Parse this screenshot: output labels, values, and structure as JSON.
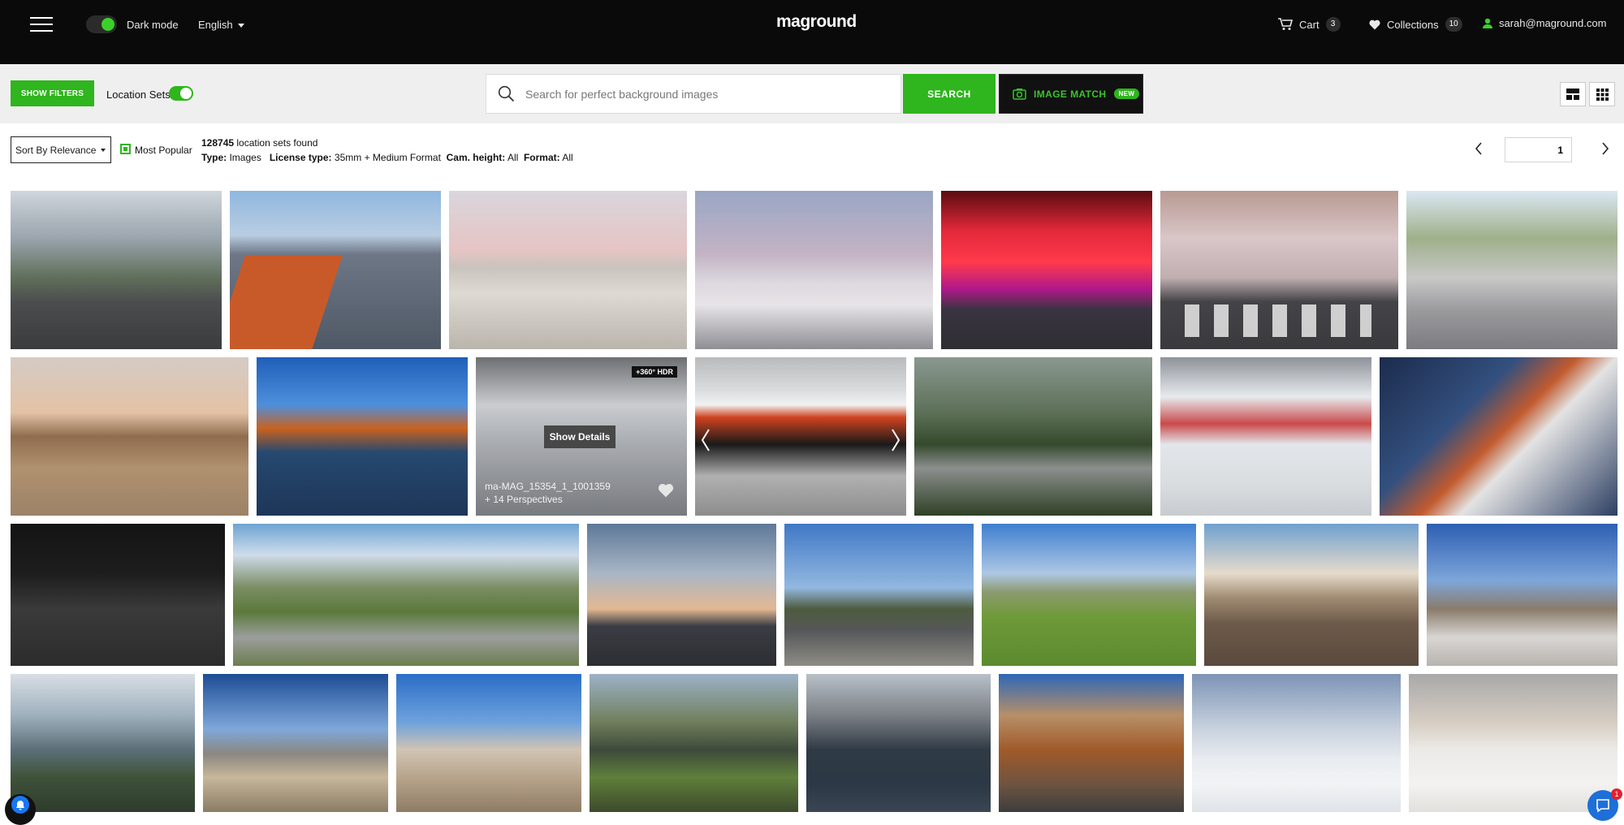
{
  "header": {
    "dark_mode_label": "Dark mode",
    "language": "English",
    "logo": "maground",
    "cart_label": "Cart",
    "cart_count": "3",
    "collections_label": "Collections",
    "collections_count": "10",
    "user_email": "sarah@maground.com"
  },
  "toolbar": {
    "show_filters_label": "SHOW FILTERS",
    "location_sets_label": "Location Sets",
    "search_placeholder": "Search for perfect background images",
    "search_button_label": "SEARCH",
    "image_match_label": "IMAGE MATCH",
    "new_badge": "NEW"
  },
  "results": {
    "sort_label": "Sort By Relevance",
    "most_popular_label": "Most Popular",
    "count": "128745",
    "count_suffix": "location sets found",
    "type_label": "Type:",
    "type_value": "Images",
    "license_label": "License type:",
    "license_value": "35mm + Medium Format",
    "cam_label": "Cam. height:",
    "cam_value": "All",
    "format_label": "Format:",
    "format_value": "All",
    "page": "1"
  },
  "hovered_card": {
    "badge": "+360° HDR",
    "show_details_label": "Show Details",
    "name": "ma-MAG_15354_1_1001359",
    "perspectives": "+ 14 Perspectives"
  },
  "chat_badge": "1",
  "colors": {
    "brand_green": "#2fb51d",
    "nav_bg": "#0a0a0a",
    "toolbar_bg": "#efefef"
  },
  "icons": [
    "menu-icon",
    "cart-icon",
    "heart-icon",
    "user-icon",
    "search-icon",
    "camera-icon",
    "grid-large-icon",
    "grid-small-icon",
    "chevron-left-icon",
    "chevron-right-icon",
    "bell-icon",
    "chat-icon"
  ]
}
